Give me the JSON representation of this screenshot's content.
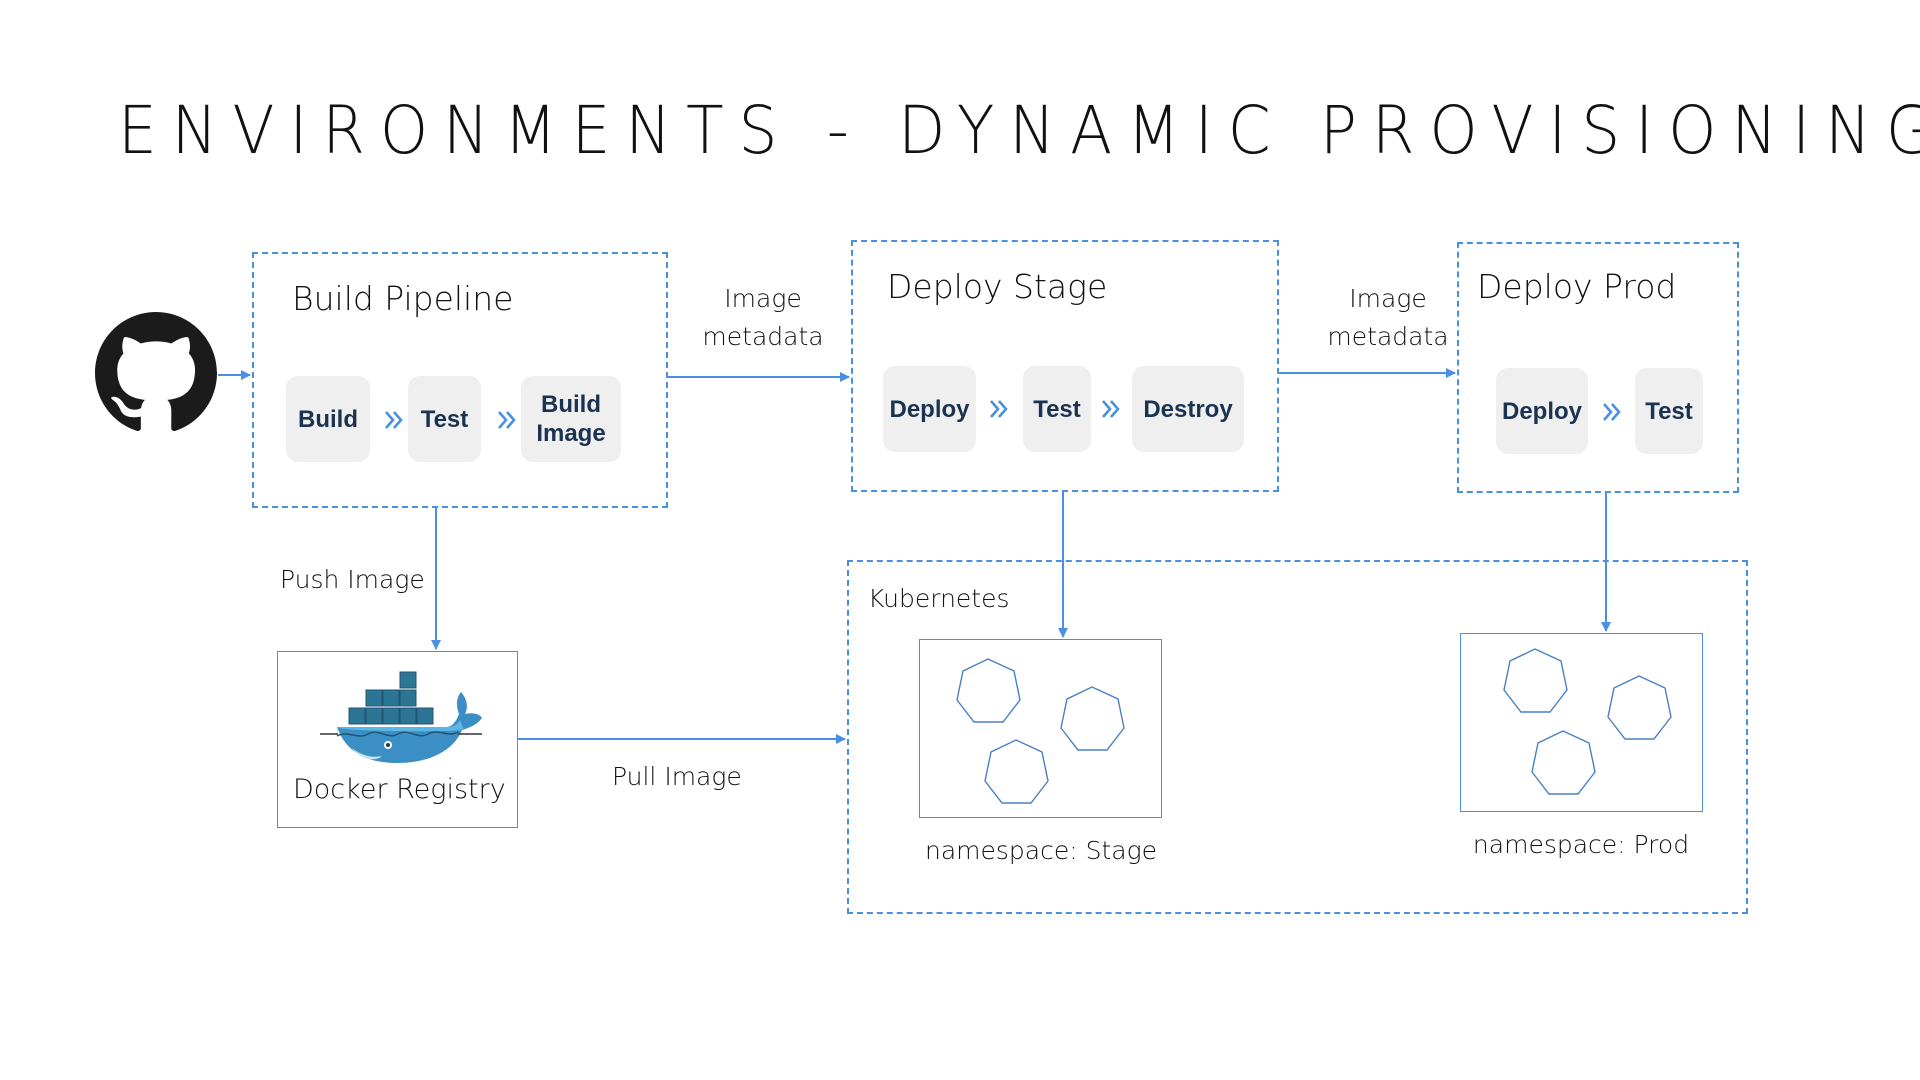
{
  "title": "ENVIRONMENTS - DYNAMIC PROVISIONING",
  "colors": {
    "accent": "#4a90e2",
    "card_bg": "#efefef",
    "card_text": "#1a3350",
    "text": "#111111"
  },
  "source": {
    "icon": "github-icon"
  },
  "build_pipeline": {
    "title": "Build Pipeline",
    "stages": [
      "Build",
      "Test",
      "Build Image"
    ]
  },
  "deploy_stage": {
    "title": "Deploy Stage",
    "stages": [
      "Deploy",
      "Test",
      "Destroy"
    ]
  },
  "deploy_prod": {
    "title": "Deploy Prod",
    "stages": [
      "Deploy",
      "Test"
    ]
  },
  "edges": {
    "image_metadata_1": [
      "Image",
      "metadata"
    ],
    "image_metadata_2": [
      "Image",
      "metadata"
    ],
    "push_image": "Push Image",
    "pull_image": "Pull Image"
  },
  "registry": {
    "label": "Docker Registry",
    "icon": "docker-icon"
  },
  "kubernetes": {
    "label": "Kubernetes",
    "namespaces": [
      {
        "label": "namespace: Stage",
        "pods": 3
      },
      {
        "label": "namespace: Prod",
        "pods": 3
      }
    ]
  }
}
